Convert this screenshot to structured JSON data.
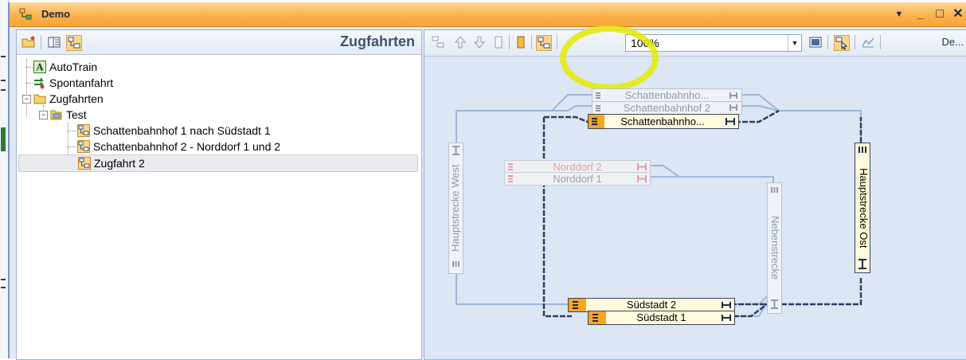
{
  "window": {
    "title": "Demo",
    "controls": {
      "menu": "▼",
      "minimize": "_",
      "maximize": "□",
      "close": "✕"
    }
  },
  "left_panel": {
    "title": "Zugfahrten",
    "toolbar": [
      "open-folder-icon",
      "list-view-icon",
      "tree-view-icon"
    ],
    "tree": [
      {
        "label": "AutoTrain",
        "icon": "autotrain-icon"
      },
      {
        "label": "Spontanfahrt",
        "icon": "spontaneous-route-icon"
      },
      {
        "label": "Zugfahrten",
        "icon": "folder-icon"
      },
      {
        "label": "Test",
        "icon": "folder-open-icon"
      },
      {
        "label": "Schattenbahnhof 1 nach Südstadt 1",
        "icon": "route-icon"
      },
      {
        "label": "Schattenbahnhof 2 - Norddorf 1 und 2",
        "icon": "route-icon"
      },
      {
        "label": "Zugfahrt 2",
        "icon": "route-icon",
        "selected": true
      }
    ]
  },
  "right_panel": {
    "toolbar": {
      "zoom": "100%",
      "more_label": "De...",
      "icons": [
        "arrange-icon",
        "move-up-icon",
        "move-down-icon",
        "block-empty-icon",
        "block-highlight-icon",
        "route-view-icon",
        "fit-window-icon",
        "select-route-icon",
        "graph-icon"
      ]
    },
    "diagram": {
      "blocks": [
        {
          "label": "Schattenbahnho...",
          "state": "inactive"
        },
        {
          "label": "Schattenbahnhof 2",
          "state": "inactive"
        },
        {
          "label": "Schattenbahnho...",
          "state": "active"
        },
        {
          "label": "Norddorf 2",
          "state": "disabled"
        },
        {
          "label": "Norddorf 1",
          "state": "disabled"
        },
        {
          "label": "Hauptstrecke West",
          "state": "inactive"
        },
        {
          "label": "Nebenstrecke",
          "state": "inactive"
        },
        {
          "label": "Hauptstrecke Ost",
          "state": "active"
        },
        {
          "label": "Südstadt 2",
          "state": "active"
        },
        {
          "label": "Südstadt 1",
          "state": "active"
        }
      ]
    }
  },
  "colors": {
    "title_bar": "#f7a43a",
    "block_active_fill": "#fffbdc",
    "block_active_cap": "#f5a623",
    "route_line": "#2c3e63",
    "inactive_line": "#9fb6d8",
    "highlight": "#e5ea00"
  }
}
